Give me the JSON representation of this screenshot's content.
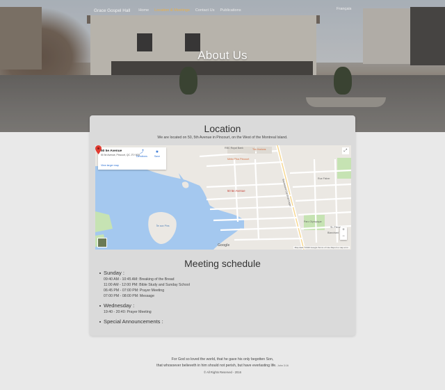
{
  "nav": {
    "brand": "Grace Gospel Hall",
    "items": [
      {
        "label": "Home",
        "active": false
      },
      {
        "label": "Location & Meetings",
        "active": true
      },
      {
        "label": "Contact Us",
        "active": false
      },
      {
        "label": "Publications",
        "active": false
      }
    ],
    "language": "Français"
  },
  "hero": {
    "title": "About Us"
  },
  "location": {
    "title": "Location",
    "text": "We are located on 50, 5th Avenue in Pincourt, on the West of the Montreal Island.",
    "map": {
      "place_name": "50 5e Avenue",
      "address": "50 5e Avenue, Pincourt, QC J7V 8G5",
      "directions_label": "Directions",
      "save_label": "Save",
      "larger_map_label": "View larger map",
      "pin_label": "50 5e Avenue",
      "labels": {
        "rbc": "RBC Royal Bank",
        "tim": "Tim Hortons",
        "metro": "Metro Plus Pincourt",
        "ile": "Île aux Pins",
        "bd": "Boulevard Cardinal-Léger",
        "rue_fisher": "Rue Fisher",
        "park": "Parc Olympique",
        "st_pierre": "St. Pierre",
        "blanchard": "Blanchard"
      },
      "zoom_in": "+",
      "zoom_out": "−",
      "google": "Google",
      "footer": "Map data ©2016 Google   Terms of Use   Report a map error"
    }
  },
  "meetings": {
    "title": "Meeting schedule",
    "days": [
      {
        "name": "Sunday :",
        "entries": [
          "09:40 AM - 10:45 AM: Breaking of the Bread",
          "11:00 AM - 12:00 PM: Bible Study and Sunday School",
          "06:45 PM - 07:00 PM: Prayer Meeting",
          "07:00 PM - 08:00 PM: Message"
        ]
      },
      {
        "name": "Wednesday :",
        "entries": [
          "19:40 - 20:40: Prayer Meeting"
        ]
      },
      {
        "name": "Special Announcements :",
        "entries": []
      }
    ]
  },
  "footer": {
    "verse_line1": "For God so loved the world, that he gave his only begotten Son,",
    "verse_line2": "that whosoever believeth in him should not perish, but have everlasting life.",
    "verse_ref": "John 3:16",
    "copyright": "© All Rights Reserved - 2016"
  },
  "colors": {
    "nav_active": "#e9b04a",
    "map_water": "#a4c8ef",
    "map_pin": "#e13c32",
    "link": "#2a6fd3"
  }
}
